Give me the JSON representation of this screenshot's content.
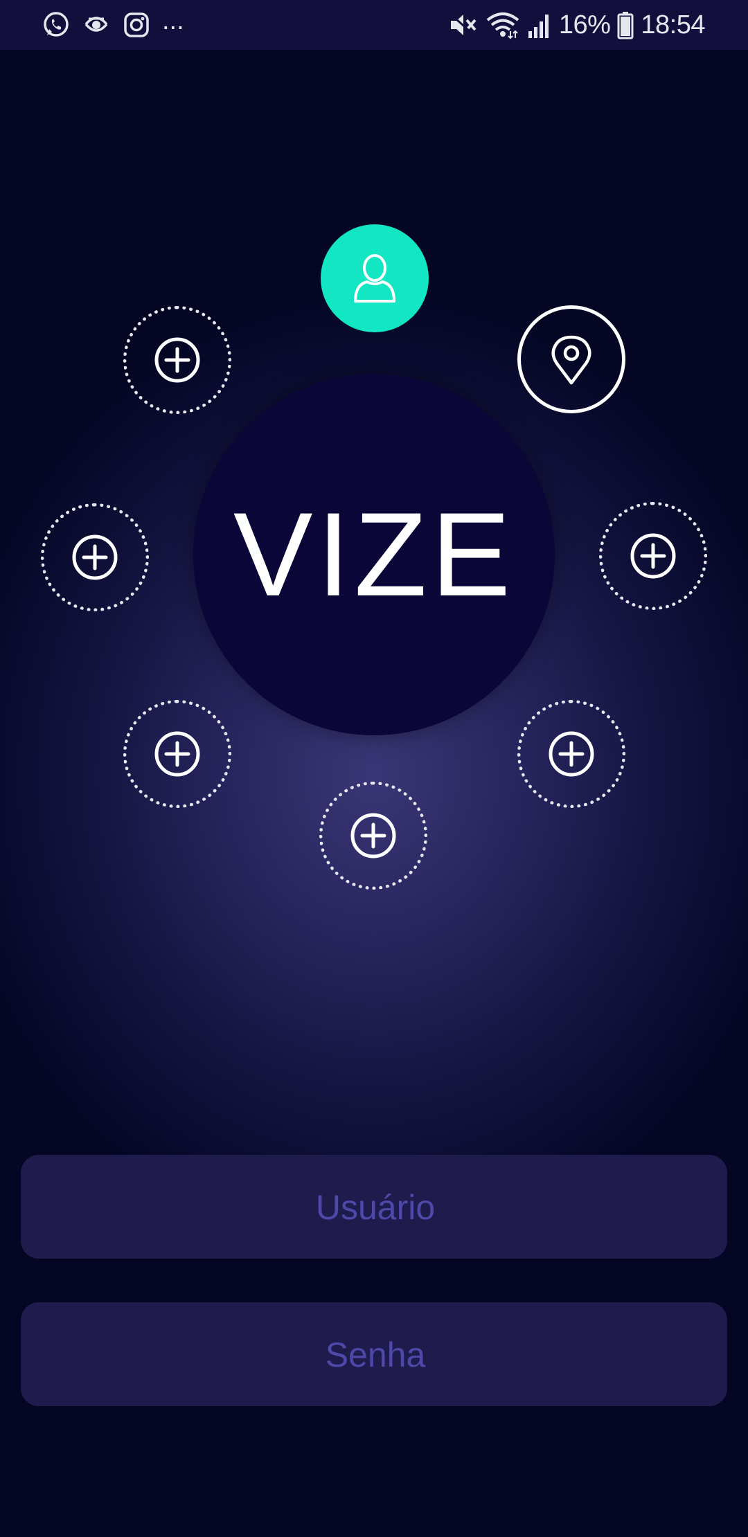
{
  "status_bar": {
    "left_icons": [
      "whatsapp-icon",
      "sync-app-icon",
      "instagram-icon"
    ],
    "more_indicator": "...",
    "right_icons": [
      "mute-icon",
      "wifi-icon",
      "signal-icon",
      "battery-icon"
    ],
    "battery_text": "16%",
    "time": "18:54"
  },
  "app": {
    "logo_text": "VIZE",
    "accent_color": "#12e6c2",
    "background_color": "#030521",
    "field_color": "#1f1b4d",
    "placeholder_color": "#4e48a8"
  },
  "satellites": {
    "profile_icon": "user-icon",
    "location_icon": "location-pin-icon",
    "add_icon": "plus-circle-icon"
  },
  "login": {
    "username_placeholder": "Usuário",
    "password_placeholder": "Senha"
  }
}
